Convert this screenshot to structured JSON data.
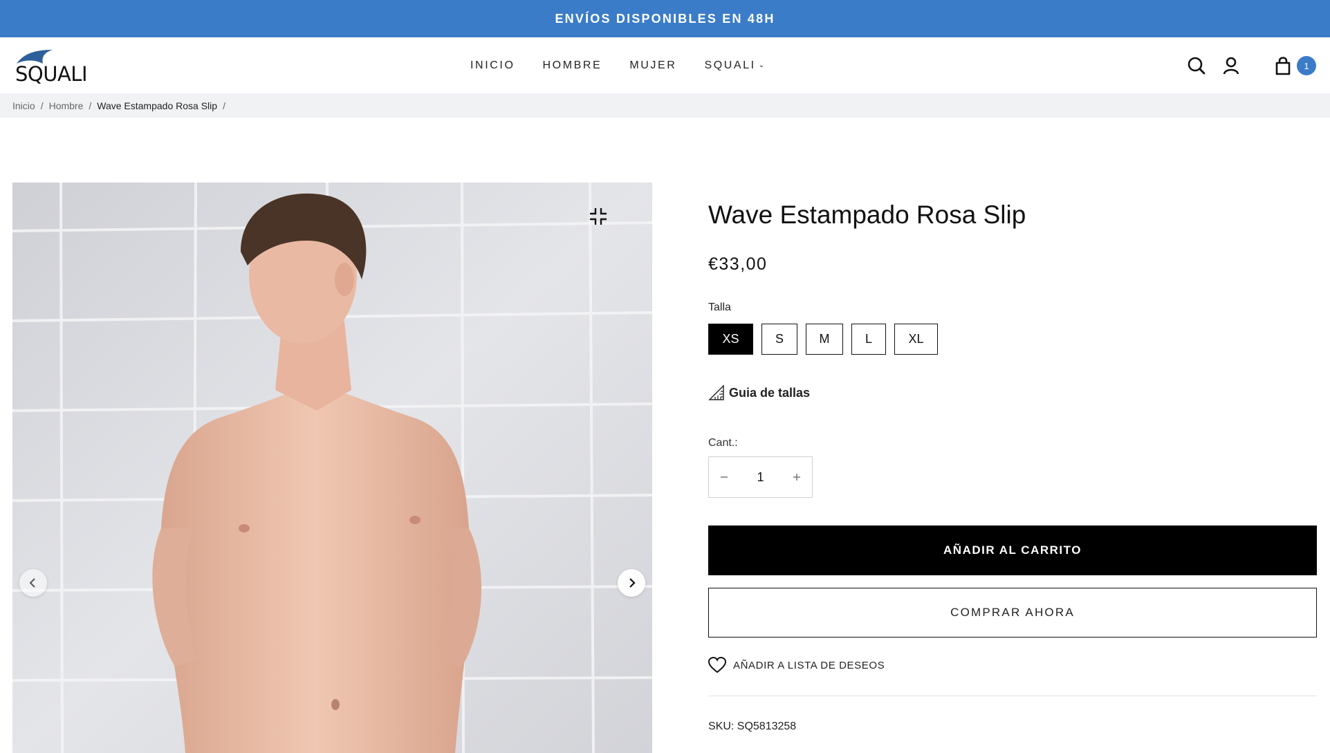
{
  "announcement": {
    "text": "ENVÍOS DISPONIBLES EN 48H"
  },
  "header": {
    "logo_text": "SQUALI",
    "nav": [
      {
        "label": "INICIO"
      },
      {
        "label": "HOMBRE"
      },
      {
        "label": "MUJER"
      },
      {
        "label": "SQUALI",
        "has_dropdown": true
      }
    ],
    "icons": [
      "search-icon",
      "account-icon",
      "cart-icon"
    ],
    "cart_count": "1"
  },
  "breadcrumb": {
    "items": [
      "Inicio",
      "Hombre"
    ],
    "current": "Wave Estampado Rosa Slip",
    "separator": "/"
  },
  "gallery": {
    "icons": [
      "zoom-icon",
      "chevron-left-icon",
      "chevron-right-icon"
    ]
  },
  "product": {
    "title": "Wave Estampado Rosa Slip",
    "price": "€33,00",
    "size_label": "Talla",
    "sizes": [
      "XS",
      "S",
      "M",
      "L",
      "XL"
    ],
    "selected_size": "XS",
    "size_guide_label": "Guia de tallas",
    "quantity_label": "Cant.:",
    "quantity": "1",
    "add_to_cart_label": "AÑADIR AL CARRITO",
    "buy_now_label": "COMPRAR AHORA",
    "wishlist_label": "AÑADIR A LISTA DE DESEOS",
    "sku": "SKU: SQ5813258"
  },
  "colors": {
    "accent": "#3b7cc8",
    "primary_button": "#000000",
    "breadcrumb_bg": "#f1f2f4"
  }
}
